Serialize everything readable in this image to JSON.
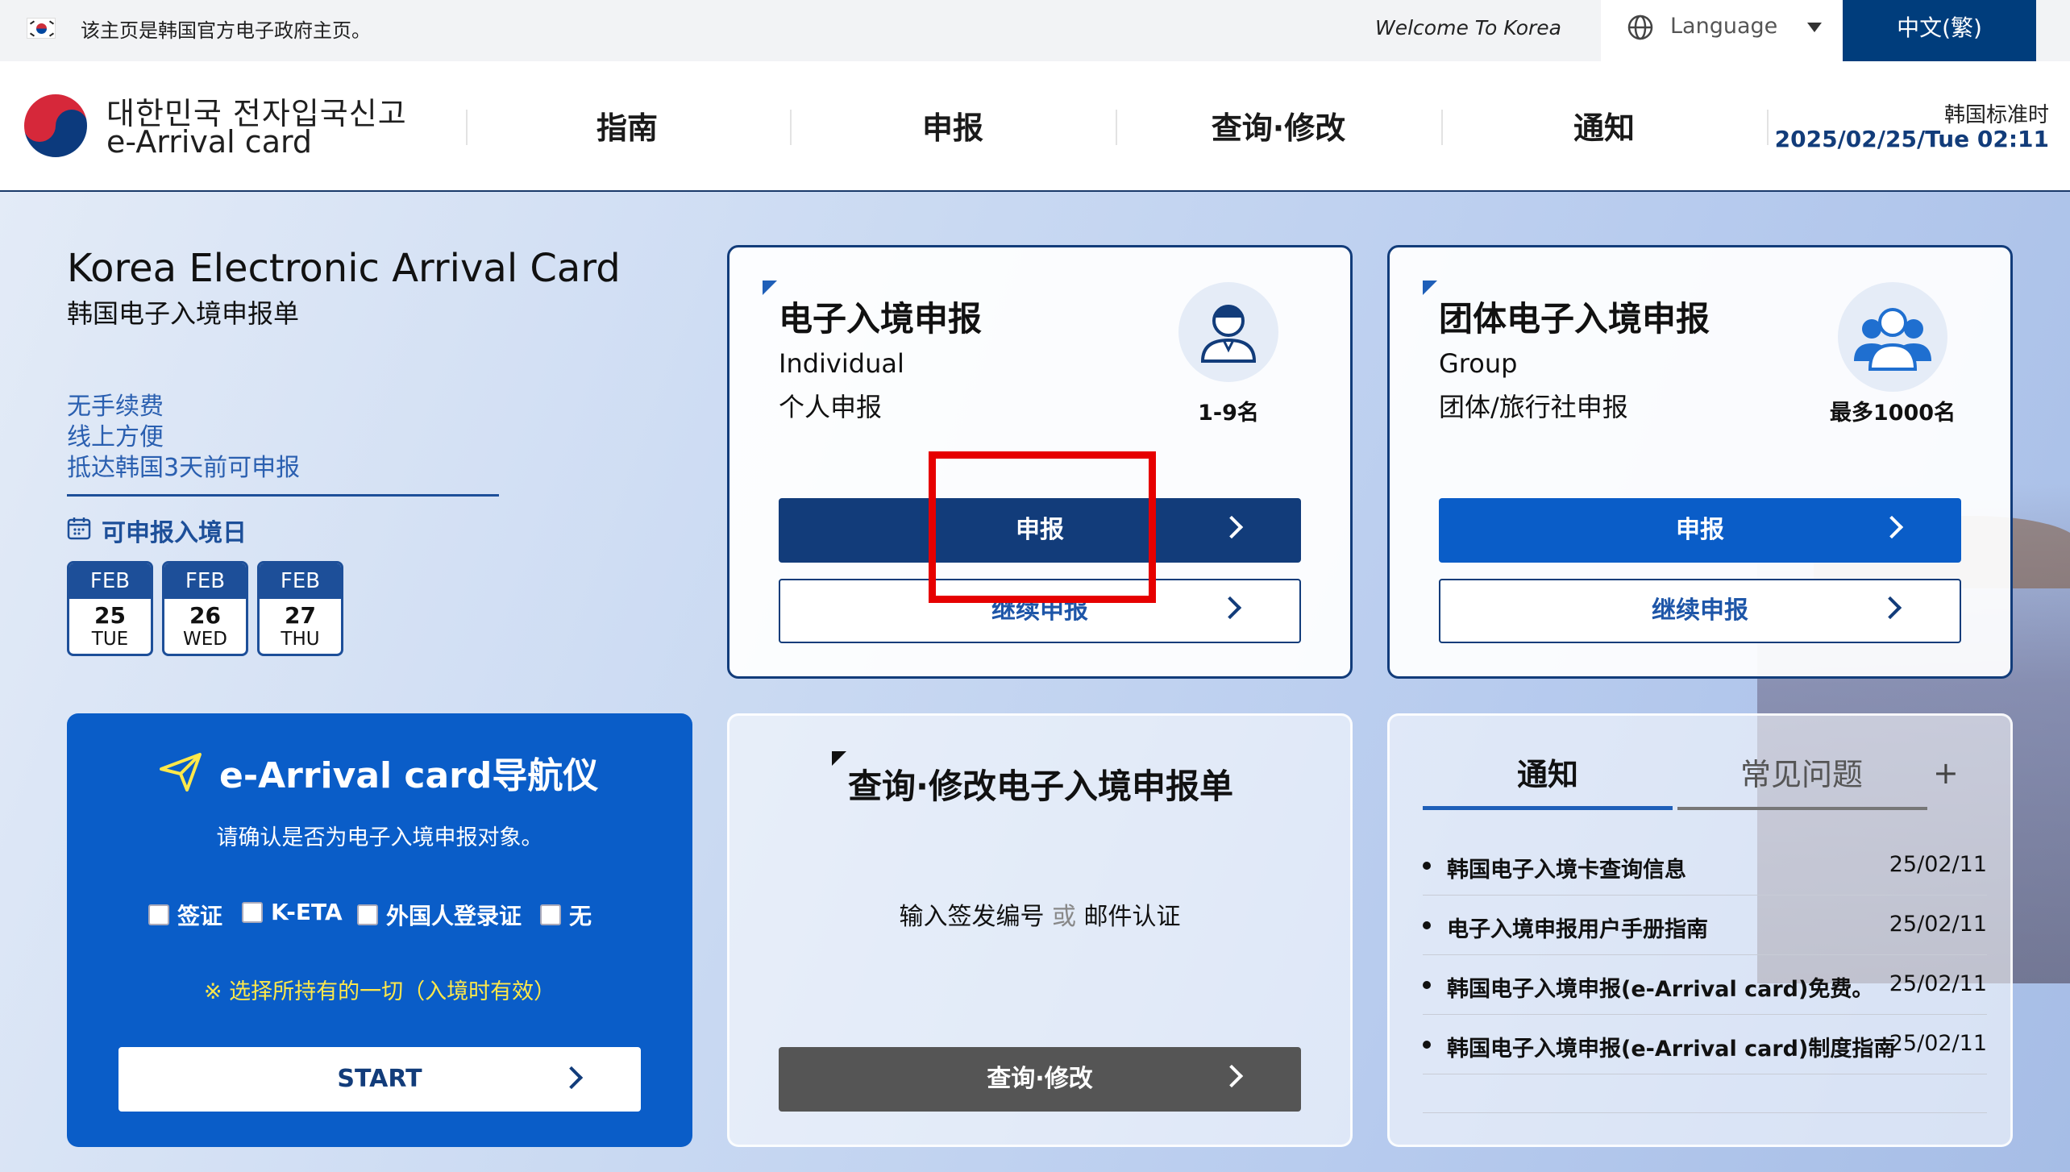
{
  "topbar": {
    "gov_note": "该主页是韩国官方电子政府主页。",
    "welcome": "Welcome To Korea",
    "language_label": "Language",
    "current_language": "中文(繁)"
  },
  "header": {
    "logo_ko": "대한민국 전자입국신고",
    "logo_en": "e-Arrival card",
    "nav": [
      "指南",
      "申报",
      "查询·修改",
      "通知"
    ],
    "time_label": "韩国标准时",
    "time_value": "2025/02/25/Tue 02:11"
  },
  "intro": {
    "title": "Korea Electronic Arrival Card",
    "subtitle": "韩国电子入境申报单",
    "features": [
      "无手续费",
      "线上方便",
      "抵达韩国3天前可申报"
    ],
    "available_label": "可申报入境日",
    "dates": [
      {
        "month": "FEB",
        "day": "25",
        "weekday": "TUE"
      },
      {
        "month": "FEB",
        "day": "26",
        "weekday": "WED"
      },
      {
        "month": "FEB",
        "day": "27",
        "weekday": "THU"
      }
    ]
  },
  "individual": {
    "title": "电子入境申报",
    "sub_en": "Individual",
    "sub_zh": "个人申报",
    "count": "1-9名",
    "primary_label": "申报",
    "secondary_label": "继续申报"
  },
  "group": {
    "title": "团体电子入境申报",
    "sub_en": "Group",
    "sub_zh": "团体/旅行社申报",
    "count": "最多1000名",
    "primary_label": "申报",
    "secondary_label": "继续申报"
  },
  "navigator": {
    "title": "e-Arrival card导航仪",
    "description": "请确认是否为电子入境申报对象。",
    "options": [
      "签证",
      "K-ETA",
      "外国人登录证",
      "无"
    ],
    "note": "※ 选择所持有的一切（入境时有效）",
    "start_label": "START"
  },
  "lookup": {
    "title": "查询·修改电子入境申报单",
    "desc_part1": "输入签发编号",
    "desc_or": "或",
    "desc_part2": "邮件认证",
    "button_label": "查询·修改"
  },
  "notices": {
    "tab_notice": "通知",
    "tab_faq": "常见问题",
    "plus": "+",
    "items": [
      {
        "text": "韩国电子入境卡查询信息",
        "date": "25/02/11"
      },
      {
        "text": "电子入境申报用户手册指南",
        "date": "25/02/11"
      },
      {
        "text": "韩国电子入境申报(e-Arrival card)免费。",
        "date": "25/02/11"
      },
      {
        "text": "韩国电子入境申报(e-Arrival card)制度指南",
        "date": "25/02/11"
      }
    ]
  },
  "colors": {
    "navy": "#123c7a",
    "primary_blue": "#0a5dc8",
    "dark_gray_button": "#555555",
    "highlight_red": "#e60000"
  }
}
